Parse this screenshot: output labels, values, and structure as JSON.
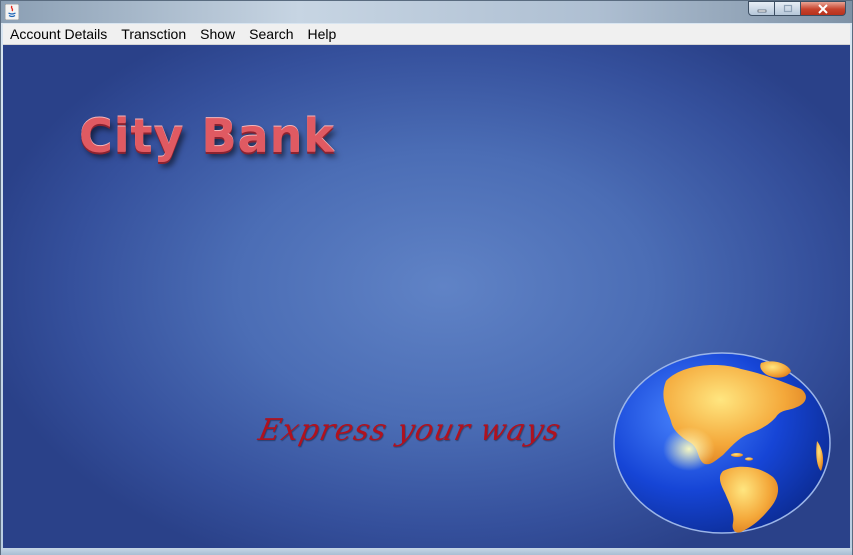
{
  "window": {
    "title": "",
    "controls": {
      "minimize_icon": "minimize-icon",
      "maximize_icon": "maximize-icon",
      "close_icon": "close-icon"
    }
  },
  "menubar": {
    "items": [
      {
        "label": "Account Details"
      },
      {
        "label": "Transction"
      },
      {
        "label": "Show"
      },
      {
        "label": "Search"
      },
      {
        "label": "Help"
      }
    ]
  },
  "splash": {
    "title": "City Bank",
    "slogan": "Express your ways",
    "image_icon": "globe-icon"
  },
  "colors": {
    "background_center": "#6083c6",
    "background_edge": "#2a4189",
    "title_color": "#e05a62",
    "slogan_color": "#b0121f"
  }
}
